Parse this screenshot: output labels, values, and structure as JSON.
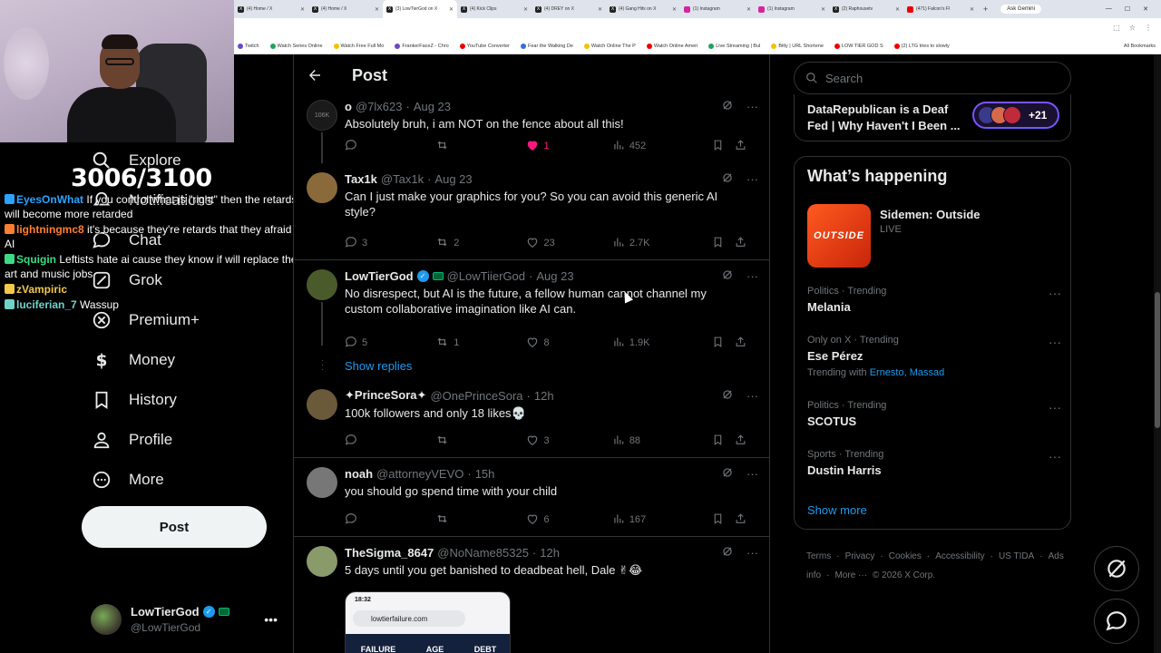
{
  "browser": {
    "tabs": [
      {
        "label": "(4) Home / X",
        "fav": "X"
      },
      {
        "label": "(4) Home / X",
        "fav": "X"
      },
      {
        "label": "(3) LowTierGod on X",
        "fav": "X",
        "active": true
      },
      {
        "label": "(4) Kick Clips",
        "fav": "X"
      },
      {
        "label": "(4) DREY on X",
        "fav": "X"
      },
      {
        "label": "(4) Gang Hits on X",
        "fav": "X"
      },
      {
        "label": "(1) Instagram",
        "fav": "ig"
      },
      {
        "label": "(1) Instagram",
        "fav": "ig"
      },
      {
        "label": "(2) Raphousetv",
        "fav": "X"
      },
      {
        "label": "(471) Falcon's Fl",
        "fav": "yt"
      }
    ],
    "new_tab": "+",
    "ask_gemini": "Ask Gemini",
    "bookmarks": [
      {
        "label": "Twitch",
        "dot": ""
      },
      {
        "label": "Watch Series Online",
        "dot": "g"
      },
      {
        "label": "Watch Free Full Mo",
        "dot": "y"
      },
      {
        "label": "FrankerFaceZ - Chro",
        "dot": ""
      },
      {
        "label": "YouTube Converter",
        "dot": "r"
      },
      {
        "label": "Fear the Walking De",
        "dot": "b"
      },
      {
        "label": "Watch Online The P",
        "dot": "y"
      },
      {
        "label": "Watch Online Ameri",
        "dot": "r"
      },
      {
        "label": "Live Streaming | Bul",
        "dot": "g"
      },
      {
        "label": "Bitly | URL Shortene",
        "dot": "y"
      },
      {
        "label": "LOW TIER GOD S",
        "dot": "r"
      },
      {
        "label": "(2) LTG tries to slowly",
        "dot": "r"
      }
    ],
    "all_bookmarks": "All Bookmarks"
  },
  "overlay": {
    "sub_count": "3006/3100",
    "chat": [
      {
        "user": "EyesOnWhat",
        "color": "#2aa4ff",
        "msg": "If you control what is \"right\" then the retards will become more retarded"
      },
      {
        "user": "lightningmc8",
        "color": "#ff7f32",
        "msg": "it's because they're retards that they afraid of AI"
      },
      {
        "user": "Squigin",
        "color": "#3ddc84",
        "msg": "Leftists hate ai cause they know if will replace their art and music jobs"
      },
      {
        "user": "zVampiric",
        "color": "#f2c94c",
        "msg": ""
      },
      {
        "user": "luciferian_7",
        "color": "#6fd3c8",
        "msg": "Wassup"
      }
    ]
  },
  "sidebar": {
    "items": [
      {
        "label": "Explore",
        "icon": "search-icon"
      },
      {
        "label": "Notifications",
        "icon": "bell-icon"
      },
      {
        "label": "Chat",
        "icon": "chat-icon"
      },
      {
        "label": "Grok",
        "icon": "grok-icon"
      },
      {
        "label": "Premium+",
        "icon": "x-icon"
      },
      {
        "label": "Money",
        "icon": "money-icon"
      },
      {
        "label": "History",
        "icon": "bookmark-icon"
      },
      {
        "label": "Profile",
        "icon": "profile-icon"
      },
      {
        "label": "More",
        "icon": "more-circle-icon"
      }
    ],
    "post_label": "Post",
    "account": {
      "name": "LowTierGod",
      "handle": "@LowTierGod"
    }
  },
  "main": {
    "title": "Post",
    "show_replies": "Show replies",
    "tweets": [
      {
        "name": "o",
        "handle": "@7lx623",
        "time": "Aug 23",
        "text": "Absolutely bruh, i am NOT on the fence about all this!",
        "replies": "",
        "reposts": "",
        "likes": "1",
        "liked": true,
        "views": "452",
        "avatar": "#1a1a1a",
        "avatar_text": "106K"
      },
      {
        "name": "Tax1k",
        "handle": "@Tax1k",
        "time": "Aug 23",
        "text": "Can I just make your graphics for you? So you can avoid this generic AI style?",
        "replies": "3",
        "reposts": "2",
        "likes": "23",
        "liked": false,
        "views": "2.7K",
        "avatar": "#8a6a3a",
        "avatar_text": ""
      },
      {
        "name": "LowTierGod",
        "handle": "@LowTiierGod",
        "time": "Aug 23",
        "text": "No disrespect, but AI is the future, a fellow human cannot channel my custom collaborative imagination like AI can.",
        "replies": "5",
        "reposts": "1",
        "likes": "8",
        "liked": false,
        "views": "1.9K",
        "avatar": "#4a5a2a",
        "avatar_text": ""
      },
      {
        "name": "✦PrinceSora✦",
        "handle": "@OnePrinceSora",
        "time": "12h",
        "text": "100k followers and only 18 likes💀",
        "replies": "",
        "reposts": "",
        "likes": "3",
        "liked": false,
        "views": "88",
        "avatar": "#6a5a3a",
        "avatar_text": ""
      },
      {
        "name": "noah",
        "handle": "@attorneyVEVO",
        "time": "15h",
        "text": "you should go spend time with your child",
        "replies": "",
        "reposts": "",
        "likes": "6",
        "liked": false,
        "views": "167",
        "avatar": "#777",
        "avatar_text": ""
      },
      {
        "name": "TheSigma_8647",
        "handle": "@NoName85325",
        "time": "12h",
        "text": "5 days until you get banished to deadbeat hell, Dale ✌😂",
        "replies": "",
        "reposts": "",
        "likes": "",
        "liked": false,
        "views": "",
        "avatar": "#8a9a6a",
        "avatar_text": ""
      }
    ],
    "phone": {
      "status": "18:32",
      "url": "lowtierfailure.com",
      "tabs": [
        "FAILURE",
        "AGE",
        "DEBT"
      ]
    }
  },
  "right": {
    "search_placeholder": "Search",
    "live_title": "DataRepublican is a Deaf Fed | Why Haven't I Been ...",
    "live_count": "+21",
    "happening_title": "What’s happening",
    "featured": {
      "name": "Sidemen: Outside",
      "status": "LIVE",
      "img_text": "OUTSIDE"
    },
    "trends": [
      {
        "meta": "Politics · Trending",
        "name": "Melania",
        "with": ""
      },
      {
        "meta": "Only on X · Trending",
        "name": "Ese Pérez",
        "with_prefix": "Trending with",
        "with": "Ernesto, Massad"
      },
      {
        "meta": "Politics · Trending",
        "name": "SCOTUS",
        "with": ""
      },
      {
        "meta": "Sports · Trending",
        "name": "Dustin Harris",
        "with": ""
      }
    ],
    "show_more": "Show more",
    "footer": [
      "Terms",
      "·",
      "Privacy",
      "·",
      "Cookies",
      "·",
      "Accessibility",
      "·",
      "US TIDA",
      "·",
      "Ads info",
      "·",
      "More ···",
      "© 2026 X Corp."
    ]
  }
}
